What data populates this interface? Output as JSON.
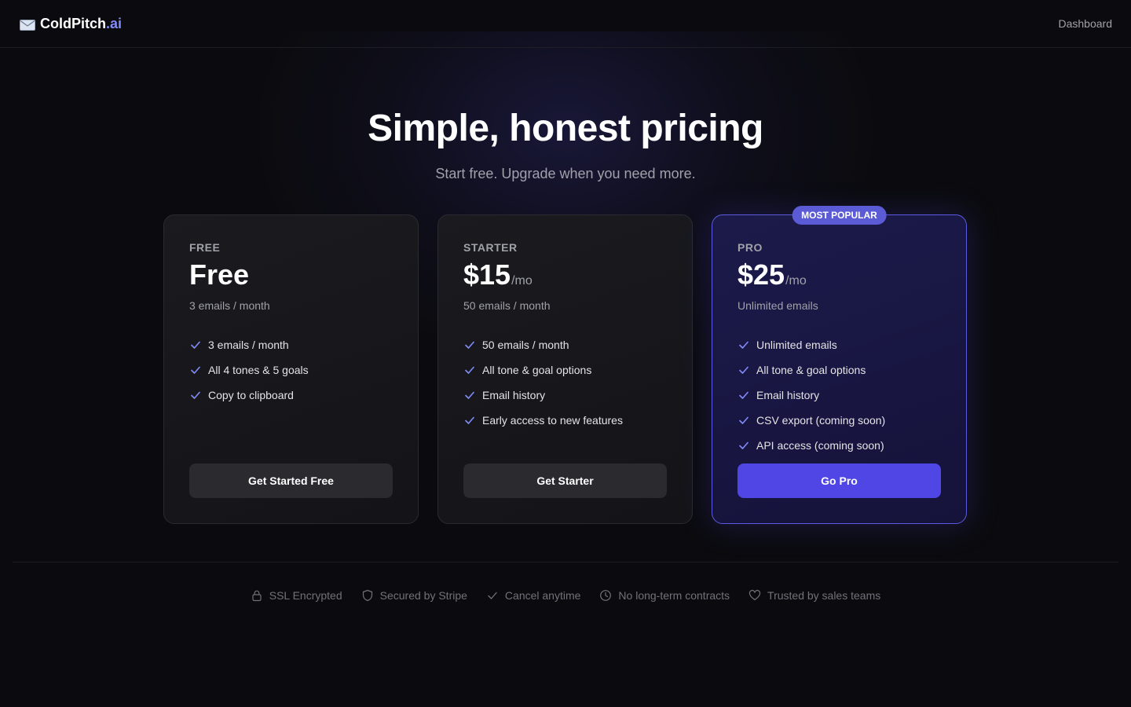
{
  "nav": {
    "logo_name": "ColdPitch",
    "logo_tld": ".ai",
    "logo_icon": "envelope-icon",
    "dashboard_label": "Dashboard"
  },
  "hero": {
    "title": "Simple, honest pricing",
    "subtitle": "Start free. Upgrade when you need more."
  },
  "plans": [
    {
      "tier": "FREE",
      "price": "Free",
      "period": "",
      "quota": "3 emails / month",
      "features": [
        "3 emails / month",
        "All 4 tones & 5 goals",
        "Copy to clipboard"
      ],
      "cta": "Get Started Free"
    },
    {
      "tier": "STARTER",
      "price": "$15",
      "period": "/mo",
      "quota": "50 emails / month",
      "features": [
        "50 emails / month",
        "All tone & goal options",
        "Email history",
        "Early access to new features"
      ],
      "cta": "Get Starter"
    },
    {
      "tier": "PRO",
      "badge": "MOST POPULAR",
      "price": "$25",
      "period": "/mo",
      "quota": "Unlimited emails",
      "features": [
        "Unlimited emails",
        "All tone & goal options",
        "Email history",
        "CSV export (coming soon)",
        "API access (coming soon)"
      ],
      "cta": "Go Pro"
    }
  ],
  "trust": [
    {
      "label": "SSL Encrypted",
      "icon": "lock-icon"
    },
    {
      "label": "Secured by Stripe",
      "icon": "shield-icon"
    },
    {
      "label": "Cancel anytime",
      "icon": "check-icon"
    },
    {
      "label": "No long-term contracts",
      "icon": "clock-icon"
    },
    {
      "label": "Trusted by sales teams",
      "icon": "heart-icon"
    }
  ],
  "colors": {
    "background": "#0b0b0f",
    "accent": "#4f46e5",
    "accent_light": "#818cf8",
    "check": "#818cf8",
    "muted_text": "#a1a1aa"
  }
}
